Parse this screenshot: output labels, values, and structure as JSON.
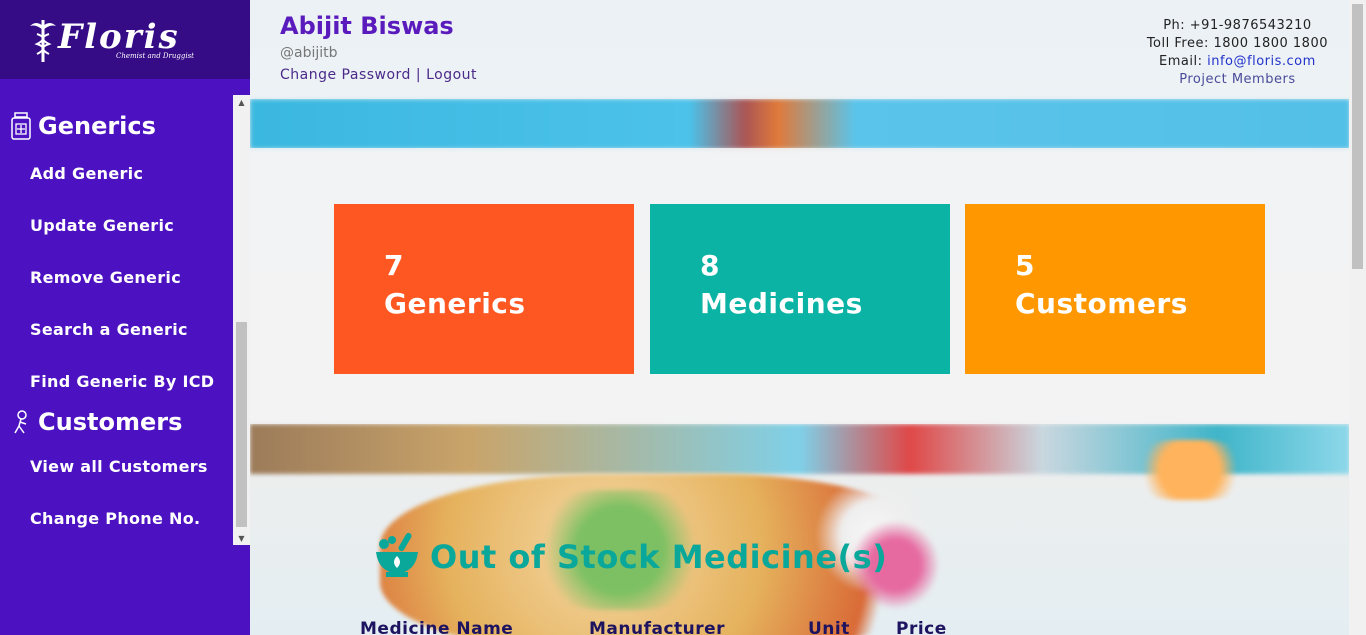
{
  "brand": {
    "name": "Floris",
    "tagline": "Chemist and Druggist"
  },
  "sidebar": {
    "sections": [
      {
        "title": "Generics",
        "icon": "medicine-bottle-icon",
        "items": [
          {
            "label": "Add Generic"
          },
          {
            "label": "Update Generic"
          },
          {
            "label": "Remove Generic"
          },
          {
            "label": "Search a Generic"
          },
          {
            "label": "Find Generic By ICD"
          }
        ]
      },
      {
        "title": "Customers",
        "icon": "customer-icon",
        "items": [
          {
            "label": "View all Customers"
          },
          {
            "label": "Change Phone No."
          }
        ]
      }
    ]
  },
  "user": {
    "name": "Abijit Biswas",
    "handle": "@abijitb",
    "change_password": "Change Password",
    "separator": "|",
    "logout": "Logout"
  },
  "contact": {
    "phone": "Ph: +91-9876543210",
    "toll_free": "Toll Free: 1800 1800 1800",
    "email_label": "Email: ",
    "email": "info@floris.com",
    "project_members": "Project Members"
  },
  "stats": [
    {
      "value": "7",
      "label": "Generics",
      "color": "#ff5722"
    },
    {
      "value": "8",
      "label": "Medicines",
      "color": "#0bb3a4"
    },
    {
      "value": "5",
      "label": "Customers",
      "color": "#ff9800"
    }
  ],
  "out_of_stock": {
    "title": "Out of Stock Medicine(s)",
    "icon": "mortar-pestle-icon",
    "columns": [
      "Medicine Name",
      "Manufacturer",
      "Unit",
      "Price"
    ]
  }
}
